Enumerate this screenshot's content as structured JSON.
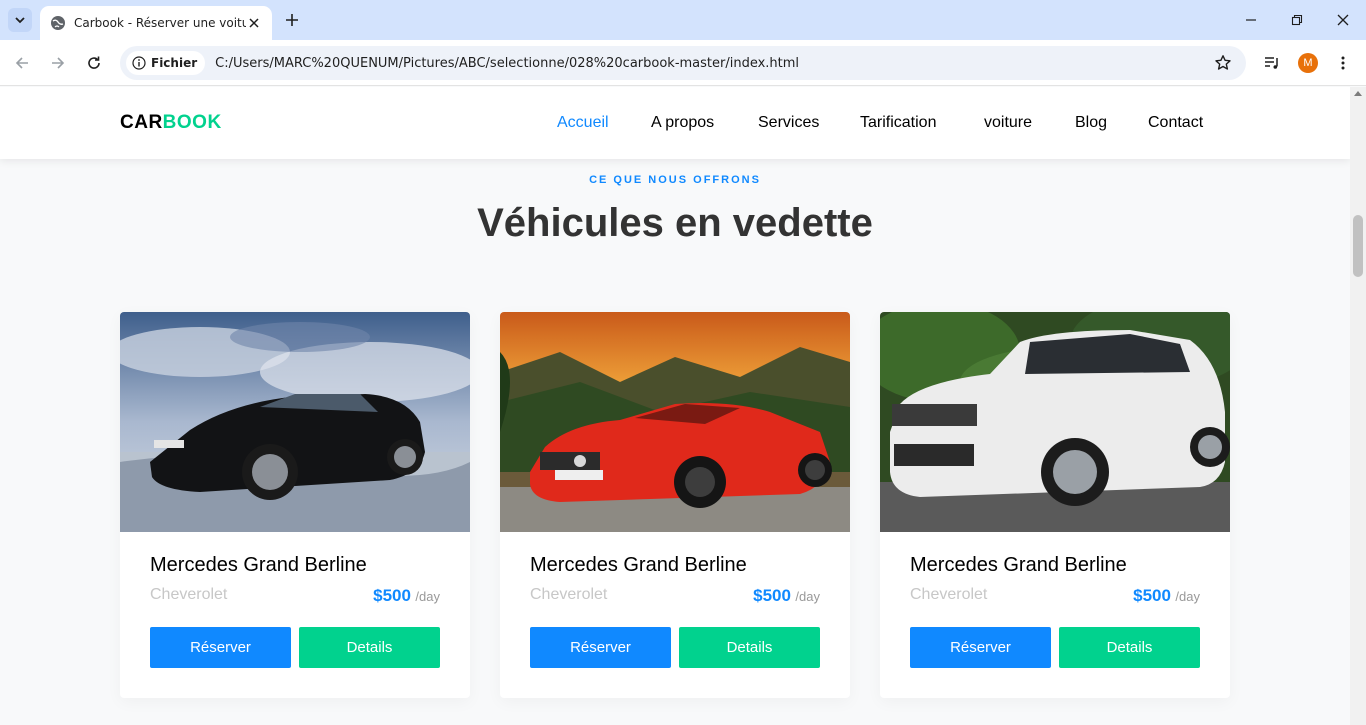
{
  "browser": {
    "tab_title": "Carbook - Réserver une voiture",
    "site_chip": "Fichier",
    "url": "C:/Users/MARC%20QUENUM/Pictures/ABC/selectionne/028%20carbook-master/index.html",
    "profile_initial": "M"
  },
  "site": {
    "logo_part1": "CAR",
    "logo_part2": "BOOK",
    "nav": [
      {
        "label": "Accueil",
        "active": true
      },
      {
        "label": "A propos",
        "active": false
      },
      {
        "label": "Services",
        "active": false
      },
      {
        "label": "Tarification",
        "active": false
      },
      {
        "label": "voiture",
        "active": false
      },
      {
        "label": "Blog",
        "active": false
      },
      {
        "label": "Contact",
        "active": false
      }
    ]
  },
  "section": {
    "subheading": "CE QUE NOUS OFFRONS",
    "heading": "Véhicules en vedette"
  },
  "cars": [
    {
      "name": "Mercedes Grand Berline",
      "brand": "Cheverolet",
      "price": "$500",
      "per": "/day",
      "book_label": "Réserver",
      "details_label": "Details",
      "image": "black-mustang"
    },
    {
      "name": "Mercedes Grand Berline",
      "brand": "Cheverolet",
      "price": "$500",
      "per": "/day",
      "book_label": "Réserver",
      "details_label": "Details",
      "image": "red-mercedes-convertible"
    },
    {
      "name": "Mercedes Grand Berline",
      "brand": "Cheverolet",
      "price": "$500",
      "per": "/day",
      "book_label": "Réserver",
      "details_label": "Details",
      "image": "white-range-rover"
    }
  ],
  "colors": {
    "primary": "#1089ff",
    "secondary": "#01d28e"
  }
}
